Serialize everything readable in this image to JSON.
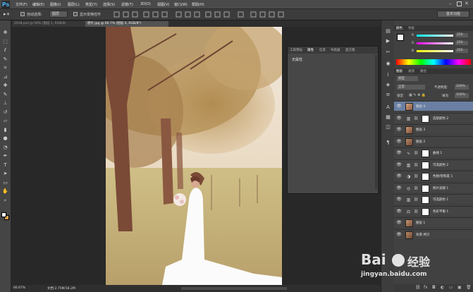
{
  "app": {
    "logo": "Ps",
    "brand_color": "#4ab2f5"
  },
  "menu": [
    "文件(F)",
    "编辑(E)",
    "图像(I)",
    "图层(L)",
    "类型(Y)",
    "选择(S)",
    "滤镜(T)",
    "3D(D)",
    "视图(V)",
    "窗口(W)",
    "帮助(H)"
  ],
  "options_bar": {
    "auto_select_label": "自动选择:",
    "auto_select_value": "图层",
    "transform_label": "显示变换控件",
    "workspace": "基本功能"
  },
  "tabs": [
    {
      "label": "2018.psd @ 50% (图层 1, RGB/8)",
      "active": false
    },
    {
      "label": "原片.jpg @ 66.7% (图层 4, RGB/8*)",
      "active": true
    }
  ],
  "tools": [
    "move-icon",
    "marquee-icon",
    "lasso-icon",
    "quick-select-icon",
    "crop-icon",
    "eyedropper-icon",
    "healing-icon",
    "brush-icon",
    "stamp-icon",
    "history-brush-icon",
    "eraser-icon",
    "gradient-icon",
    "blur-icon",
    "dodge-icon",
    "pen-icon",
    "type-icon",
    "path-select-icon",
    "shape-icon",
    "hand-icon",
    "zoom-icon"
  ],
  "status": {
    "zoom": "66.67%",
    "doc": "文档:2.75M/18.2M"
  },
  "color_panel": {
    "tabs": [
      "颜色",
      "色板"
    ],
    "channels": [
      {
        "label": "R",
        "value": "250",
        "color": "#ff4040"
      },
      {
        "label": "G",
        "value": "250",
        "color": "#40ff40"
      },
      {
        "label": "B",
        "value": "250",
        "color": "#4060ff"
      }
    ]
  },
  "properties_panel": {
    "tabs": [
      "工具预设",
      "属性",
      "信息",
      "导航器",
      "直方图"
    ],
    "body": "无属性"
  },
  "layers_panel": {
    "tabs": [
      "图层",
      "通道",
      "路径"
    ],
    "kind": "类型",
    "blend_mode": "正常",
    "opacity_label": "不透明度:",
    "opacity": "100%",
    "lock_label": "锁定:",
    "fill_label": "填充:",
    "fill": "100%",
    "layers": [
      {
        "name": "图层 4",
        "type": "photo",
        "selected": true
      },
      {
        "name": "选取颜色 2",
        "type": "adjust",
        "icon": "selective-color-icon"
      },
      {
        "name": "图层 3",
        "type": "photo"
      },
      {
        "name": "图层 2",
        "type": "photo"
      },
      {
        "name": "曲线 1",
        "type": "adjust",
        "icon": "curves-icon"
      },
      {
        "name": "可选颜色 2",
        "type": "adjust",
        "icon": "selective-color-icon"
      },
      {
        "name": "色相/饱和度 1",
        "type": "adjust",
        "icon": "hue-icon"
      },
      {
        "name": "照片滤镜 1",
        "type": "adjust",
        "icon": "photo-filter-icon"
      },
      {
        "name": "可选颜色 1",
        "type": "adjust",
        "icon": "selective-color-icon"
      },
      {
        "name": "色彩平衡 1",
        "type": "adjust",
        "icon": "color-balance-icon"
      },
      {
        "name": "图层 1",
        "type": "photo"
      },
      {
        "name": "背景 拷贝",
        "type": "photo"
      }
    ]
  },
  "watermark": {
    "brand": "Bai",
    "site": "jingyan.baidu.com",
    "label": "经验"
  }
}
